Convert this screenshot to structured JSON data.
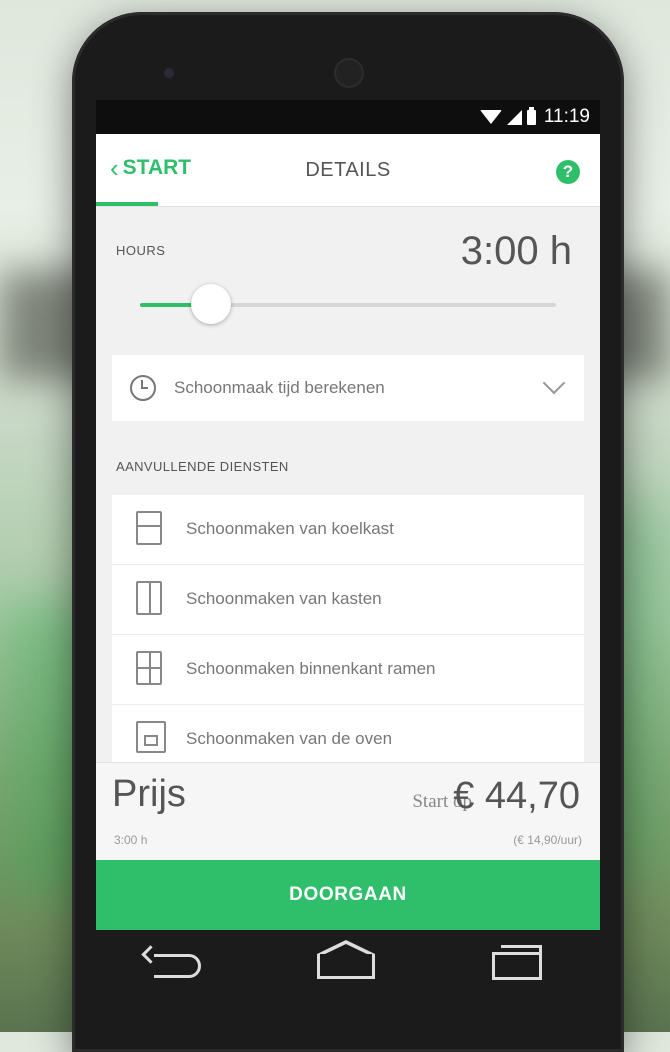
{
  "status_bar": {
    "time": "11:19"
  },
  "app_bar": {
    "back_label": "START",
    "title": "DETAILS",
    "help_label": "?"
  },
  "hours": {
    "label": "HOURS",
    "value": "3:00 h",
    "slider_fraction": 0.17
  },
  "calculate": {
    "label": "Schoonmaak tijd berekenen"
  },
  "extra_services": {
    "section_label": "AANVULLENDE DIENSTEN",
    "items": [
      {
        "icon": "fridge-icon",
        "label": "Schoonmaken van koelkast"
      },
      {
        "icon": "cabinet-icon",
        "label": "Schoonmaken van kasten"
      },
      {
        "icon": "window-icon",
        "label": "Schoonmaken binnenkant ramen"
      },
      {
        "icon": "oven-icon",
        "label": "Schoonmaken van de oven"
      }
    ]
  },
  "price": {
    "label": "Prijs",
    "hours_sub": "3:00 h",
    "start_prefix": "Start op",
    "amount": "€ 44,70",
    "per_hour": "(€ 14,90/uur)"
  },
  "cta": {
    "label": "DOORGAAN"
  },
  "colors": {
    "accent": "#2fbf6a"
  }
}
